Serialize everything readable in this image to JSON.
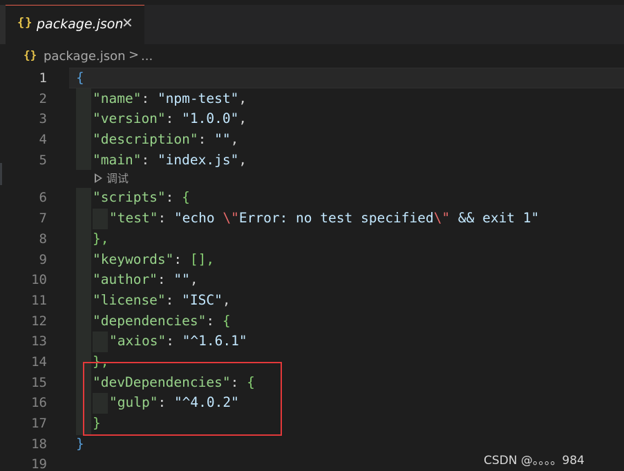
{
  "tab": {
    "icon": "{}",
    "label": "package.json",
    "close_icon": "✕"
  },
  "breadcrumb": {
    "icon": "{}",
    "file": "package.json",
    "separator": ">",
    "more": "..."
  },
  "codelens": {
    "label": "调试"
  },
  "line_numbers": [
    "1",
    "2",
    "3",
    "4",
    "5",
    "6",
    "7",
    "8",
    "9",
    "10",
    "11",
    "12",
    "13",
    "14",
    "15",
    "16",
    "17",
    "18",
    "19"
  ],
  "code": {
    "l1": "{",
    "l2_key": "\"name\"",
    "l2_val": "\"npm-test\"",
    "l3_key": "\"version\"",
    "l3_val": "\"1.0.0\"",
    "l4_key": "\"description\"",
    "l4_val": "\"\"",
    "l5_key": "\"main\"",
    "l5_val": "\"index.js\"",
    "l6_key": "\"scripts\"",
    "l7_key": "\"test\"",
    "l7_val_a": "\"echo ",
    "l7_esc1": "\\\"",
    "l7_val_b": "Error: no test specified",
    "l7_esc2": "\\\"",
    "l7_val_c": " && exit 1\"",
    "l8": "},",
    "l9_key": "\"keywords\"",
    "l9_val": "[],",
    "l10_key": "\"author\"",
    "l10_val": "\"\"",
    "l11_key": "\"license\"",
    "l11_val": "\"ISC\"",
    "l12_key": "\"dependencies\"",
    "l13_key": "\"axios\"",
    "l13_val": "\"^1.6.1\"",
    "l14": "},",
    "l15_key": "\"devDependencies\"",
    "l16_key": "\"gulp\"",
    "l16_val": "\"^4.0.2\"",
    "l17": "}",
    "l18": "}"
  },
  "watermark": "CSDN @。。。。984",
  "colors": {
    "accent_tab_border": "#e65d4c",
    "json_icon": "#e8c54b",
    "annotation_box": "#e3393a"
  }
}
